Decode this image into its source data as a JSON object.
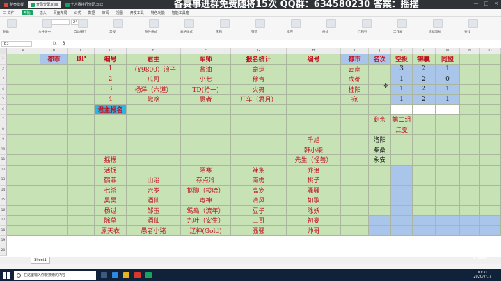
{
  "window": {
    "tabs": [
      {
        "label": "稻壳模板",
        "color": "#e0463b"
      },
      {
        "label": "开局分配.xlsx",
        "color": "#1aa260"
      },
      {
        "label": "十人赛排行分配.xlsx",
        "color": "#1aa260"
      }
    ],
    "banner": "各赛事进群免费随将15次 QQ群：634580230 答案：摇摆",
    "controls": [
      "—",
      "□",
      "×"
    ]
  },
  "menu": {
    "items": [
      "三 文件",
      "开始",
      "插入",
      "页面布局",
      "公式",
      "数据",
      "审阅",
      "视图",
      "开发工具",
      "特色功能",
      "智能工具箱"
    ]
  },
  "ribbon": {
    "font_name": "宋体",
    "font_size": "24",
    "labels": [
      "粘贴",
      "合并居中",
      "自动换行",
      "常规",
      "条件格式",
      "表格样式",
      "求和",
      "筛选",
      "排序",
      "格式",
      "行和列",
      "工作表",
      "冻结窗格",
      "查找"
    ]
  },
  "formula_bar": {
    "cell_ref": "B3",
    "fx": "fx",
    "value": "3"
  },
  "columns": [
    "A",
    "B",
    "C",
    "D",
    "E",
    "F",
    "G",
    "H",
    "I",
    "J",
    "K",
    "L",
    "M",
    "N",
    "O",
    "P",
    "Q"
  ],
  "rows": [
    "1",
    "2",
    "3",
    "4",
    "5",
    "6",
    "7",
    "8",
    "9",
    "10",
    "11",
    "12",
    "13",
    "14",
    "15",
    "16",
    "17",
    "18",
    "19",
    "20"
  ],
  "sheet": {
    "header": [
      "都市",
      "BP",
      "编号",
      "君主",
      "军师",
      "报名统计",
      "编号",
      "都市",
      "名次",
      "空投",
      "锦囊",
      "同盟"
    ],
    "r1": [
      "",
      "",
      "1",
      "（Y9800）浪子",
      "酱油",
      "命运",
      "",
      "云南",
      "",
      "3",
      "2",
      "1"
    ],
    "r2": [
      "",
      "",
      "2",
      "瓜哥",
      "小七",
      "穆青",
      "",
      "成都",
      "",
      "1",
      "2",
      "0"
    ],
    "r3": [
      "",
      "",
      "3",
      "杨洋（六道）",
      "TD(拾一)",
      "火舞",
      "",
      "桂阳",
      "",
      "1",
      "2",
      "1"
    ],
    "r4": [
      "",
      "",
      "4",
      "瞅啥",
      "愚者",
      "开车（君月）",
      "",
      "宛",
      "",
      "1",
      "2",
      "1"
    ],
    "r5": [
      "",
      "",
      "君主报名",
      "",
      "",
      "",
      "",
      "",
      "",
      "",
      "",
      ""
    ],
    "r6": [
      "",
      "",
      "",
      "",
      "",
      "",
      "",
      "",
      "剩余",
      "第二组",
      "",
      ""
    ],
    "r7": [
      "",
      "",
      "",
      "",
      "",
      "",
      "",
      "",
      "",
      "江夏",
      "",
      ""
    ],
    "r8": [
      "",
      "",
      "",
      "",
      "",
      "",
      "千旭",
      "",
      "洛阳",
      "",
      "",
      ""
    ],
    "r9": [
      "",
      "",
      "",
      "",
      "",
      "",
      "韩小柒",
      "",
      "柴桑",
      "",
      "",
      ""
    ],
    "r10": [
      "",
      "",
      "摇摆",
      "",
      "",
      "",
      "先生（怪兽）",
      "",
      "永安",
      "",
      "",
      ""
    ],
    "r11": [
      "",
      "",
      "活捉",
      "",
      "陌寒",
      "辣条",
      "乔治",
      "",
      "",
      "",
      "",
      ""
    ],
    "r12": [
      "",
      "",
      "鹤菲",
      "山治",
      "存点冷",
      "南栀",
      "桃子",
      "",
      "",
      "",
      "",
      ""
    ],
    "r13": [
      "",
      "",
      "七杀",
      "六岁",
      "抠脚（梭哈）",
      "高宠",
      "骚骚",
      "",
      "",
      "",
      "",
      ""
    ],
    "r14": [
      "",
      "",
      "昊昊",
      "酒仙",
      "毒神",
      "清风",
      "如歌",
      "",
      "",
      "",
      "",
      ""
    ],
    "r15": [
      "",
      "",
      "杨过",
      "邹玉",
      "鸳鸯（流年）",
      "豆子",
      "除妖",
      "",
      "",
      "",
      "",
      ""
    ],
    "r16": [
      "",
      "",
      "除草",
      "酒仙",
      "九叶（安生）",
      "三哥",
      "初宴",
      "",
      "",
      "",
      "",
      ""
    ],
    "r17": [
      "",
      "",
      "原天衣",
      "愚者小猪",
      "辽神(Gold)",
      "骚骚",
      "帅哥",
      "",
      "",
      "",
      "",
      ""
    ]
  },
  "sheet_tab": "Sheet1",
  "taskbar": {
    "search_placeholder": "在这里输入你要搜索的内容",
    "time": "10:31",
    "date": "2020/7/17"
  },
  "watermark": "斗鱼",
  "colors": {
    "cell_green": "#c7e3b6",
    "cell_blue": "#a9c6ea",
    "cell_cyan": "#2bb6e5",
    "text_red": "#c0111f"
  }
}
